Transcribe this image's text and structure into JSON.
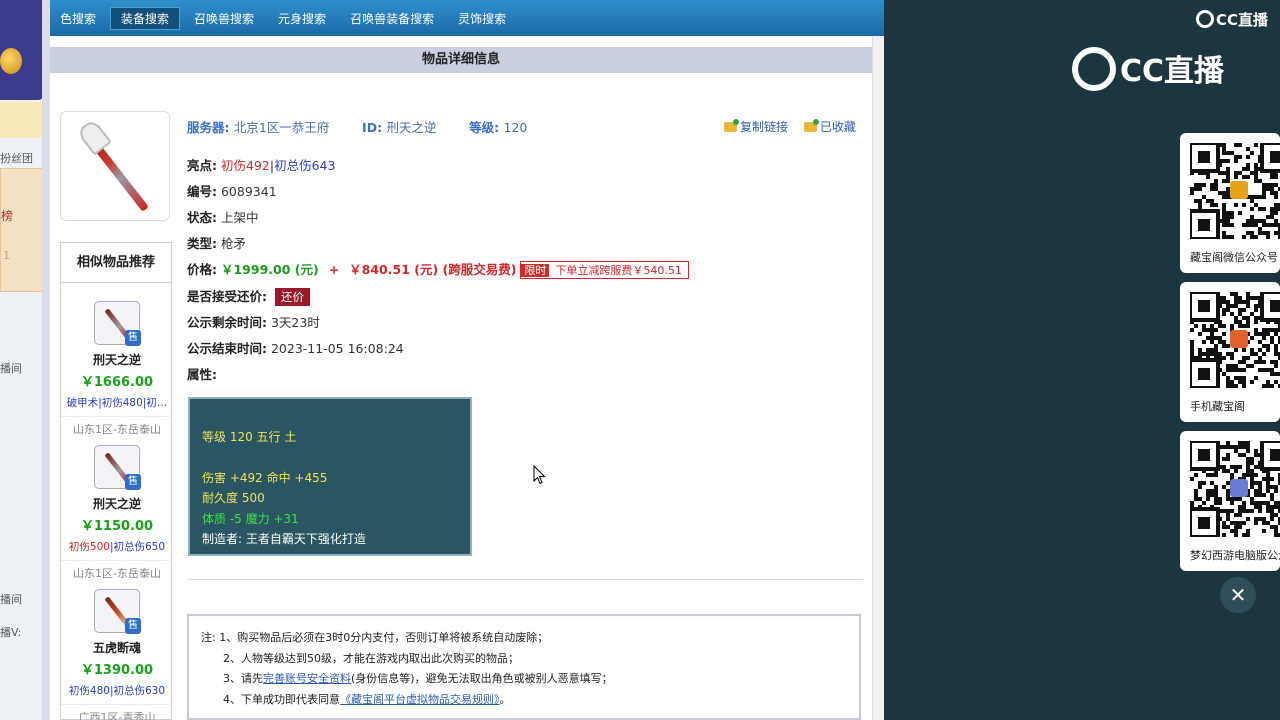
{
  "left_strip": {
    "label1": "扮丝团",
    "label2": "榜",
    "label3": "1",
    "label4": "播间",
    "label5": "播间",
    "label6": "播V:"
  },
  "nav": {
    "items": [
      {
        "label": "色搜索",
        "active": false
      },
      {
        "label": "装备搜索",
        "active": true
      },
      {
        "label": "召唤兽搜索",
        "active": false
      },
      {
        "label": "元身搜索",
        "active": false
      },
      {
        "label": "召唤兽装备搜索",
        "active": false
      },
      {
        "label": "灵饰搜索",
        "active": false
      }
    ]
  },
  "section_title": "物品详细信息",
  "header": {
    "server_label": "服务器:",
    "server_value": "北京1区一恭王府",
    "id_label": "ID:",
    "id_value": "刑天之逆",
    "level_label": "等级:",
    "level_value": "120",
    "copy_link": "复制链接",
    "favorited": "已收藏"
  },
  "details": {
    "highlight_label": "亮点:",
    "highlight_1": "初伤492",
    "highlight_sep": "|",
    "highlight_2": "初总伤643",
    "serial_label": "编号:",
    "serial_value": "6089341",
    "status_label": "状态:",
    "status_value": "上架中",
    "type_label": "类型:",
    "type_value": "枪矛",
    "price_label": "价格:",
    "price_main": "￥1999.00 (元)",
    "price_plus": "+",
    "price_fee": "￥840.51 (元) (跨服交易费)",
    "limit_tag": "限时",
    "limit_text": "下单立减跨服费￥540.51",
    "bargain_label": "是否接受还价:",
    "bargain_button": "还价",
    "remain_label": "公示剩余时间:",
    "remain_value": "3天23时",
    "end_label": "公示结束时间:",
    "end_value": "2023-11-05 16:08:24",
    "attr_label": "属性:"
  },
  "attributes": {
    "line1": "等级 120 五行 土",
    "line2": "伤害 +492 命中 +455",
    "line3": "耐久度 500",
    "line4": "体质 -5 魔力 +31",
    "line5": "制造者: 王者自霸天下强化打造"
  },
  "recommend": {
    "title": "相似物品推荐",
    "sale_badge": "售",
    "items": [
      {
        "name": "刑天之逆",
        "price": "￥1666.00",
        "tag_a": "破甲术",
        "tag_b": "|初伤480|初…",
        "server": "山东1区-东岳泰山"
      },
      {
        "name": "刑天之逆",
        "price": "￥1150.00",
        "tag_a": "初伤500",
        "tag_b": "|初总伤650",
        "server": "山东1区-东岳泰山"
      },
      {
        "name": "五虎断魂",
        "price": "￥1390.00",
        "tag_a": "初伤480",
        "tag_b": "|初总伤630",
        "server": "广西1区-青秀山"
      }
    ]
  },
  "notes": {
    "line1": "注: 1、购买物品后必须在3时0分内支付，否则订单将被系统自动废除；",
    "line2": "2、人物等级达到50级，才能在游戏内取出此次购买的物品；",
    "line3_pre": "3、请先",
    "line3_link": "完善账号安全资料",
    "line3_post": "(身份信息等)，避免无法取出角色或被别人恶意填写；",
    "line4_pre": "4、下单成功即代表同意",
    "line4_link": "《藏宝阁平台虚拟物品交易规则》",
    "line4_post": "。"
  },
  "side": {
    "brand_small": "CC直播",
    "brand_big": "CC直播",
    "qr1_label": "藏宝阁微信公众号",
    "qr2_label": "手机藏宝阁",
    "qr3_label": "梦幻西游电脑版公众",
    "close": "✕"
  },
  "colors": {
    "nav_blue": "#1b6aa6",
    "price_green": "#1c9a1c",
    "price_red": "#d12a2a",
    "attr_bg": "#2a5663",
    "side_bg": "#1b3640"
  }
}
